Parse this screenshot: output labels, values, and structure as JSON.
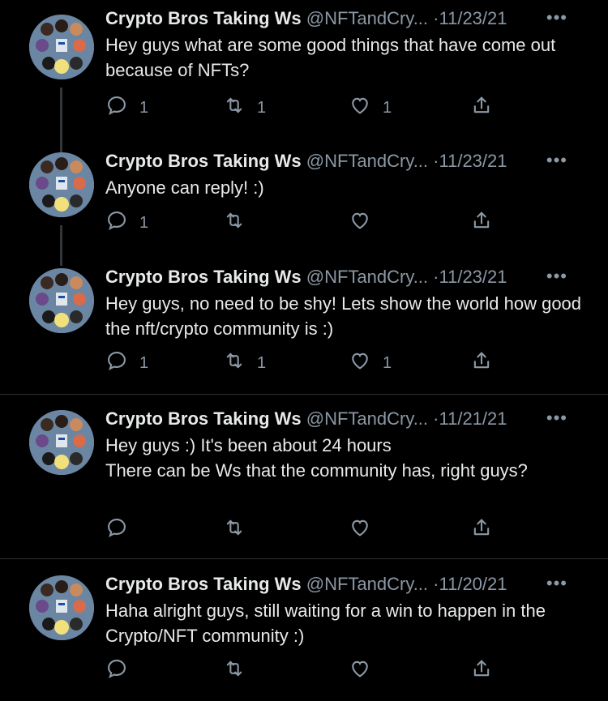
{
  "tweets": [
    {
      "name": "Crypto Bros Taking Ws",
      "handle": "@NFTandCry...",
      "sep": "·",
      "date": "11/23/21",
      "text": "Hey guys what are some good things that have come out because of NFTs?",
      "reply_count": "1",
      "retweet_count": "1",
      "like_count": "1"
    },
    {
      "name": "Crypto Bros Taking Ws",
      "handle": "@NFTandCry...",
      "sep": "·",
      "date": "11/23/21",
      "text": "Anyone can reply! :)",
      "reply_count": "1",
      "retweet_count": "",
      "like_count": ""
    },
    {
      "name": "Crypto Bros Taking Ws",
      "handle": "@NFTandCry...",
      "sep": "·",
      "date": "11/23/21",
      "text": "Hey guys, no need to be shy! Lets show the world how good the nft/crypto community is :)",
      "reply_count": "1",
      "retweet_count": "1",
      "like_count": "1"
    },
    {
      "name": "Crypto Bros Taking Ws",
      "handle": "@NFTandCry...",
      "sep": "·",
      "date": "11/21/21",
      "text": "Hey guys :) It's been about 24 hours\nThere can be Ws that the community has, right guys?",
      "reply_count": "",
      "retweet_count": "",
      "like_count": ""
    },
    {
      "name": "Crypto Bros Taking Ws",
      "handle": "@NFTandCry...",
      "sep": "·",
      "date": "11/20/21",
      "text": "Haha alright guys, still waiting for a win to happen in the Crypto/NFT community :)",
      "reply_count": "",
      "retweet_count": "",
      "like_count": ""
    }
  ],
  "more_label": "•••",
  "icons": [
    "reply-icon",
    "retweet-icon",
    "like-icon",
    "share-icon"
  ],
  "colors": {
    "background": "#000000",
    "text": "#e7e9ea",
    "muted": "#8b98a5",
    "divider": "#2f3336"
  }
}
